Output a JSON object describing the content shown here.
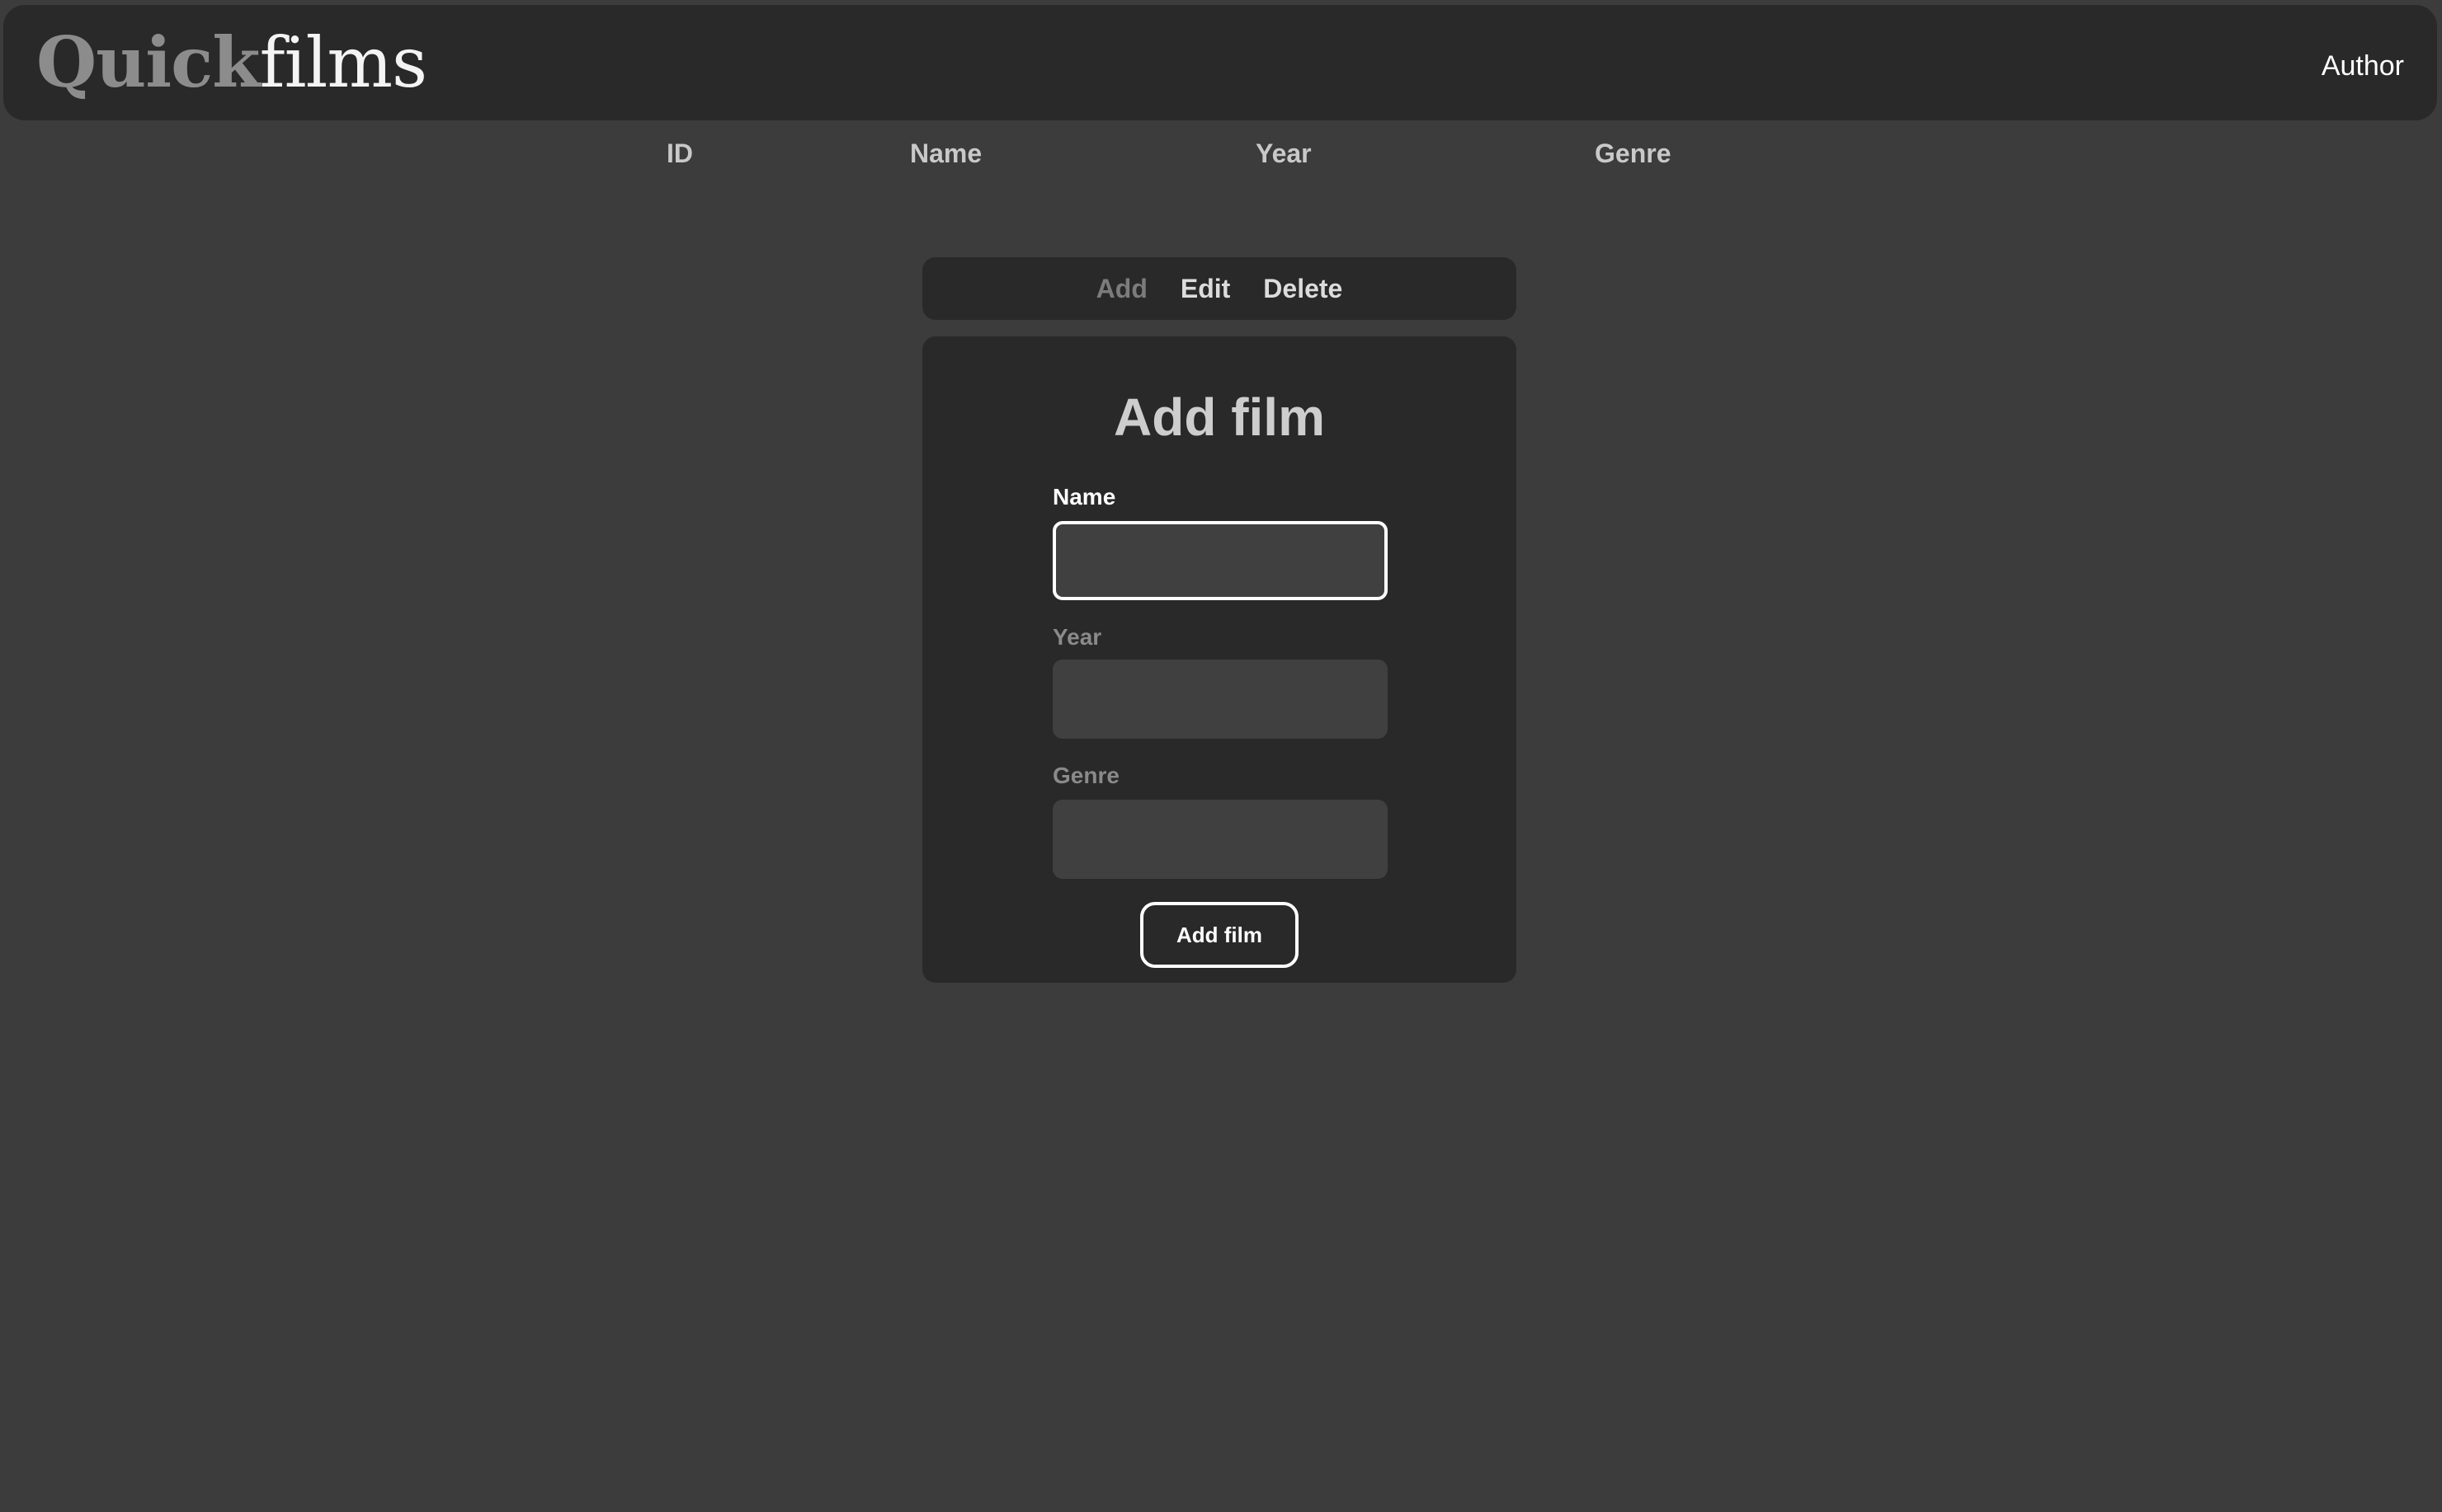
{
  "header": {
    "logo_part1": "Quick",
    "logo_part2": "films",
    "author_link": "Author"
  },
  "table": {
    "columns": [
      "ID",
      "Name",
      "Year",
      "Genre"
    ]
  },
  "tabs": [
    {
      "label": "Add",
      "active": true
    },
    {
      "label": "Edit",
      "active": false
    },
    {
      "label": "Delete",
      "active": false
    }
  ],
  "form": {
    "title": "Add film",
    "fields": [
      {
        "label": "Name",
        "value": "",
        "focused": true
      },
      {
        "label": "Year",
        "value": "",
        "focused": false
      },
      {
        "label": "Genre",
        "value": "",
        "focused": false
      }
    ],
    "submit_label": "Add film"
  },
  "colors": {
    "background": "#3c3c3c",
    "panel": "#292929",
    "input": "#404040",
    "active_tab": "#7c7c7c"
  }
}
